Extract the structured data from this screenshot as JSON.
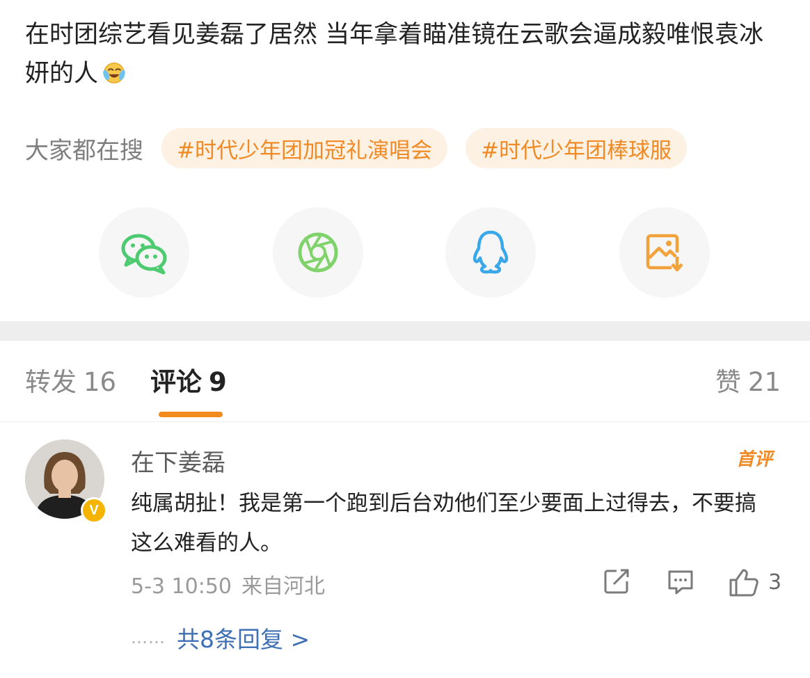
{
  "post": {
    "text": "在时团综艺看见姜磊了居然 当年拿着瞄准镜在云歌会逼成毅唯恨袁冰妍的人",
    "emoji_icon": "laugh-cry-emoji-icon"
  },
  "search": {
    "label": "大家都在搜",
    "tags": [
      "#时代少年团加冠礼演唱会",
      "#时代少年团棒球服"
    ]
  },
  "share": [
    {
      "name": "wechat-icon",
      "color": "#4ecb71"
    },
    {
      "name": "moments-icon",
      "color": "#7fd36a"
    },
    {
      "name": "qq-icon",
      "color": "#3aa8e8"
    },
    {
      "name": "save-image-icon",
      "color": "#f2a23a"
    }
  ],
  "tabs": {
    "repost_label": "转发",
    "repost_count": "16",
    "comment_label": "评论",
    "comment_count": "9",
    "like_label": "赞",
    "like_count": "21"
  },
  "comment": {
    "username": "在下姜磊",
    "badge": "首评",
    "verified_mark": "V",
    "text": "纯属胡扯！我是第一个跑到后台劝他们至少要面上过得去，不要搞这么难看的人。",
    "time": "5-3 10:50",
    "source": "来自河北",
    "like_count": "3",
    "replies_dots": "……",
    "replies_link": "共8条回复 >"
  },
  "colors": {
    "accent": "#f28a1e",
    "tag_bg": "#fdf1e4",
    "link": "#3f6fb4"
  }
}
